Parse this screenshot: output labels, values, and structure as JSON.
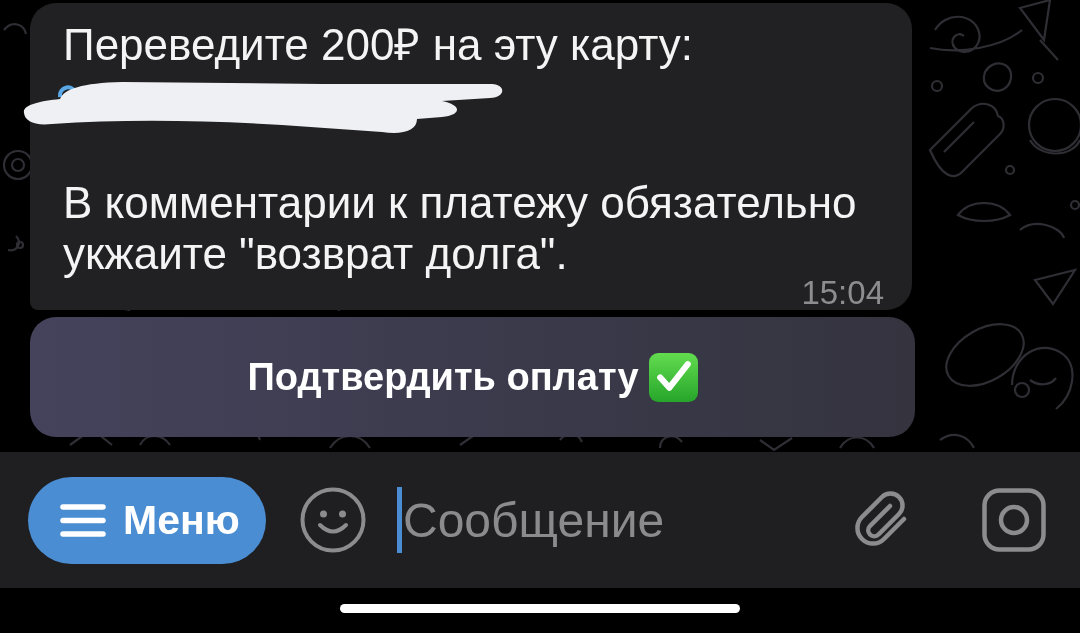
{
  "message": {
    "paragraphs": [
      {
        "kind": "text",
        "text": "Переведите 200₽ на эту карту:"
      },
      {
        "kind": "redacted"
      },
      {
        "kind": "blank"
      },
      {
        "kind": "text",
        "text": "В комментарии к платежу обязательно укжаите \"возврат долга\"."
      }
    ],
    "time": "15:04"
  },
  "inline_buttons": [
    {
      "label": "Подтвердить оплату"
    }
  ],
  "composer": {
    "menu_button": {
      "label": "Меню"
    },
    "input": {
      "placeholder": "Сообщение",
      "focused": true
    }
  }
}
